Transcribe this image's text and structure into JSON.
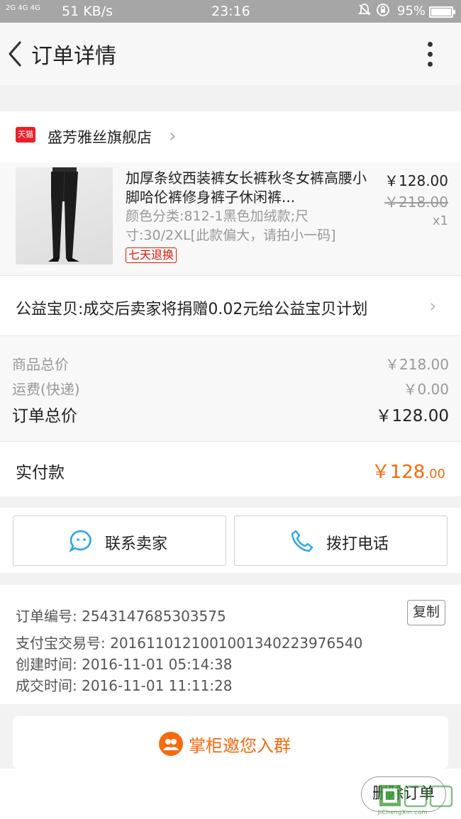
{
  "status_bar": {
    "signal": "2G 4G 4G",
    "speed": "51 KB/s",
    "time": "23:16",
    "battery": "95%"
  },
  "nav": {
    "title": "订单详情"
  },
  "shop": {
    "badge": "天猫",
    "name": "盛芳雅丝旗舰店"
  },
  "product": {
    "title": "加厚条纹西装裤女长裤秋冬女裤高腰小脚哈伦裤修身裤子休闲裤...",
    "sku": "颜色分类:812-1黑色加绒款;尺寸:30/2XL[此款偏大，请拍小一码]",
    "tag": "七天退换",
    "price": "￥128.00",
    "original_price": "￥218.00",
    "quantity": "x1"
  },
  "charity": {
    "text": "公益宝贝:成交后卖家将捐赠0.02元给公益宝贝计划"
  },
  "summary": {
    "goods_label": "商品总价",
    "goods_value": "￥218.00",
    "shipping_label": "运费(快递)",
    "shipping_value": "￥0.00",
    "total_label": "订单总价",
    "total_value": "￥128.00"
  },
  "paid": {
    "label": "实付款",
    "currency": "￥",
    "integer": "128",
    "decimal": ".00"
  },
  "actions": {
    "contact": "联系卖家",
    "call": "拨打电话"
  },
  "order_info": {
    "order_no": "订单编号: 2543147685303575",
    "alipay_no": "支付宝交易号: 2016110121001001340223976540",
    "created": "创建时间: 2016-11-01 05:14:38",
    "completed": "成交时间: 2016-11-01 11:11:28",
    "copy": "复制"
  },
  "group": {
    "label": "掌柜邀您入群"
  },
  "bottom": {
    "delete": "删除订单"
  },
  "watermark": {
    "text": "JiChengXin.com"
  },
  "colors": {
    "accent": "#f56b10",
    "link_blue": "#29a6e8",
    "tmall_red": "#e8202a"
  }
}
